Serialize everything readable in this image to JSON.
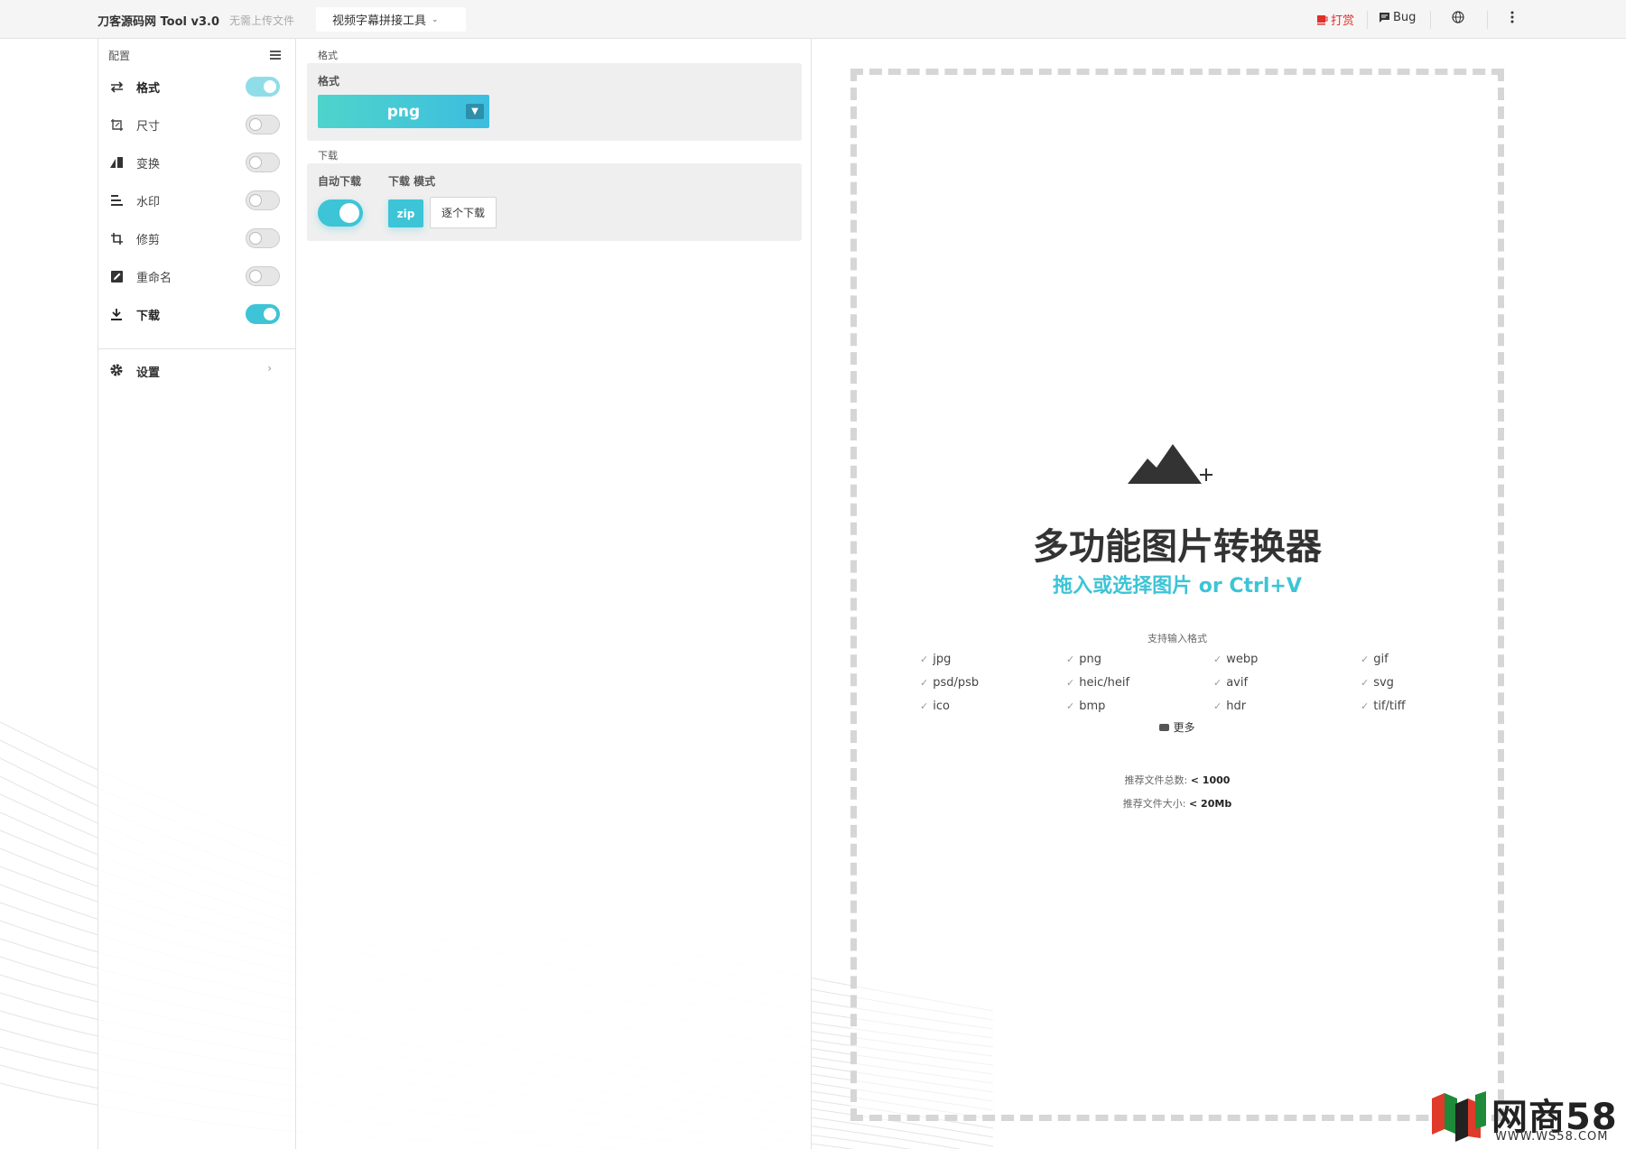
{
  "topbar": {
    "brand": "刀客源码网 Tool v3.0",
    "brand_sub": "无需上传文件",
    "tool_dropdown": "视频字幕拼接工具",
    "donate": "打赏",
    "bug": "Bug"
  },
  "sidebar": {
    "heading": "配置",
    "items": [
      {
        "label": "格式",
        "enabled": true
      },
      {
        "label": "尺寸",
        "enabled": false
      },
      {
        "label": "变换",
        "enabled": false
      },
      {
        "label": "水印",
        "enabled": false
      },
      {
        "label": "修剪",
        "enabled": false
      },
      {
        "label": "重命名",
        "enabled": false
      },
      {
        "label": "下载",
        "enabled": true
      }
    ],
    "settings": "设置"
  },
  "config": {
    "format_section": "格式",
    "format_card_title": "格式",
    "format_value": "png",
    "download_section": "下载",
    "auto_download_label": "自动下载",
    "download_mode_label": "下载 模式",
    "zip_label": "zip",
    "each_label": "逐个下载"
  },
  "dropzone": {
    "title": "多功能图片转换器",
    "subtitle": "拖入或选择图片 or Ctrl+V",
    "support_label": "支持输入格式",
    "formats": [
      "jpg",
      "png",
      "webp",
      "gif",
      "psd/psb",
      "heic/heif",
      "avif",
      "svg",
      "ico",
      "bmp",
      "hdr",
      "tif/tiff"
    ],
    "more": "更多",
    "rec_count_label": "推荐文件总数:",
    "rec_count_value": "< 1000",
    "rec_size_label": "推荐文件大小:",
    "rec_size_value": "< 20Mb"
  },
  "watermark": {
    "brand": "网商58",
    "url": "WWW.WS58.COM"
  },
  "colors": {
    "accent": "#3dc4d6",
    "donate": "#e0302a"
  }
}
